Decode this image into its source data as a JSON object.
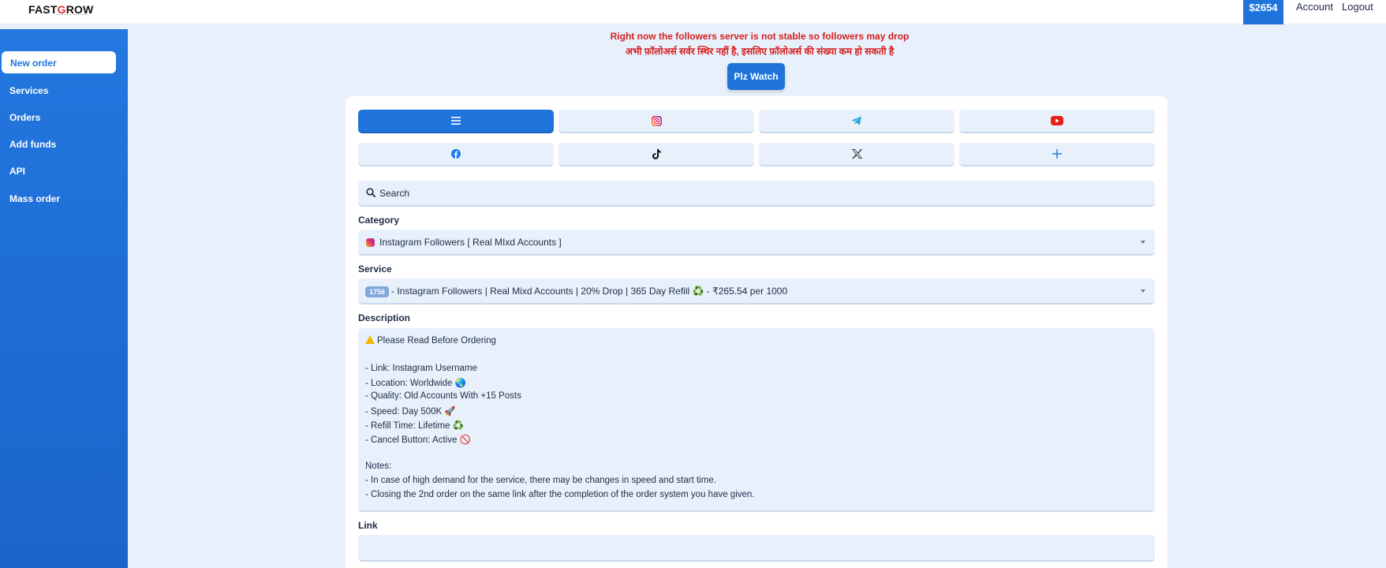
{
  "header": {
    "logo_part1": "FAST",
    "logo_part2": "G",
    "logo_part3": "ROW",
    "balance": "$2654",
    "account_label": "Account",
    "logout_label": "Logout"
  },
  "sidebar": {
    "items": [
      {
        "label": "New order"
      },
      {
        "label": "Services"
      },
      {
        "label": "Orders"
      },
      {
        "label": "Add funds"
      },
      {
        "label": "API"
      },
      {
        "label": "Mass order"
      }
    ]
  },
  "notice": {
    "line_en": "Right now the followers server is not stable so followers may drop",
    "line_hi": "अभी फ़ॉलोअर्स सर्वर स्थिर नहीं है, इसलिए फ़ॉलोअर्स की संख्या कम हो सकती है",
    "watch_button": "Plz Watch"
  },
  "tabs": [
    {
      "icon": "menu-icon",
      "active": true
    },
    {
      "icon": "instagram-icon"
    },
    {
      "icon": "telegram-icon"
    },
    {
      "icon": "youtube-icon"
    },
    {
      "icon": "facebook-icon"
    },
    {
      "icon": "tiktok-icon"
    },
    {
      "icon": "x-icon"
    },
    {
      "icon": "plus-icon"
    }
  ],
  "search": {
    "placeholder": "Search"
  },
  "form": {
    "category_label": "Category",
    "category_value": "Instagram Followers [ Real MIxd Accounts ]",
    "service_label": "Service",
    "service_id": "1756",
    "service_value": "- Instagram Followers | Real Mixd Accounts | 20% Drop | 365 Day Refill ♻️ - ₹265.54 per 1000",
    "description_label": "Description",
    "link_label": "Link",
    "link_value": ""
  },
  "description_lines": [
    "Please Read Before Ordering",
    "",
    "- Link: Instagram Username",
    "- Location: Worldwide 🌏",
    "- Quality: Old Accounts With +15 Posts",
    "- Speed: Day 500K 🚀",
    "- Refill Time: Lifetime ♻️",
    "- Cancel Button: Active 🚫",
    "",
    "Notes:",
    "- In case of high demand for the service, there may be changes in speed and start time.",
    "- Closing the 2nd order on the same link after the completion of the order system you have given."
  ],
  "colors": {
    "primary": "#1f74db",
    "notice_red": "#d41f1f",
    "field_bg": "#e8f1fb"
  }
}
